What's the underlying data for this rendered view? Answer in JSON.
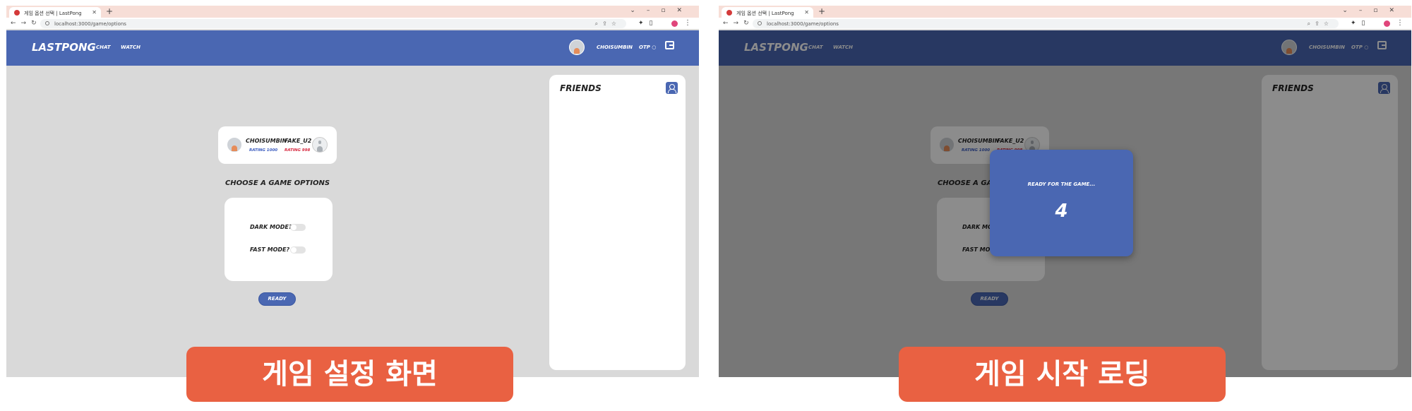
{
  "browser": {
    "tab_title": "게임 옵션 선택 | LastPong",
    "url": "localhost:3000/game/options"
  },
  "app": {
    "brand": "LASTPONG",
    "nav": [
      "CHAT",
      "WATCH"
    ],
    "user_name": "CHOISUMBIN",
    "otp_label": "OTP ○"
  },
  "friends": {
    "title": "FRIENDS"
  },
  "match": {
    "player1": {
      "name": "CHOISUMBIN",
      "rating": "RATING 1000"
    },
    "player2": {
      "name": "FAKE_U2",
      "rating": "RATING 998"
    }
  },
  "options": {
    "heading": "CHOOSE A GAME OPTIONS",
    "dark_mode": "DARK MODE?",
    "fast_mode": "FAST MODE?",
    "dark_mode_on": false,
    "fast_mode_on": false,
    "ready": "READY"
  },
  "loading": {
    "message": "READY FOR THE GAME...",
    "countdown": "4"
  },
  "captions": {
    "left": "게임 설정 화면",
    "right": "게임 시작 로딩"
  },
  "colors": {
    "header": "#4a67b2",
    "caption": "#e96142",
    "rating1": "#3a5bbf",
    "rating2": "#d6263d"
  }
}
